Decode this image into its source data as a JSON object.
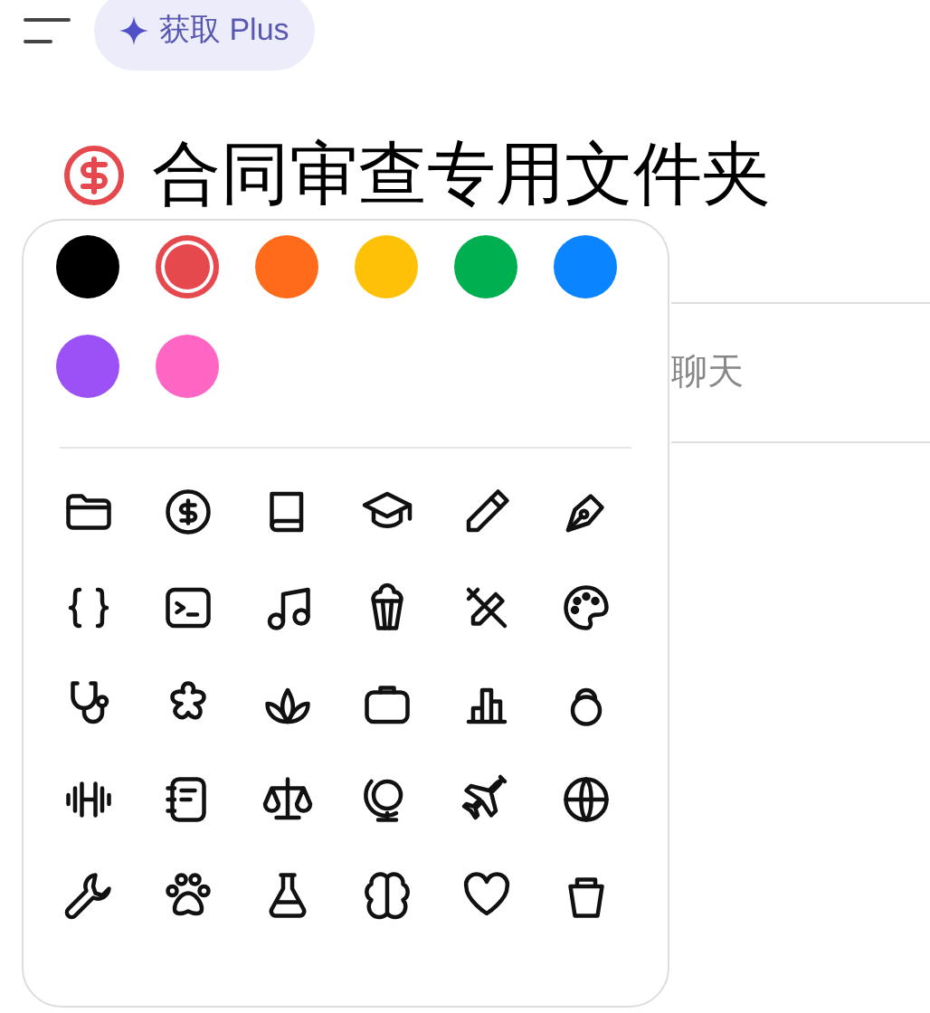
{
  "header": {
    "upgrade_button": {
      "label": "获取 Plus"
    }
  },
  "project": {
    "title": "合同审查专用文件夹"
  },
  "chat_field": {
    "placeholder": "聊天"
  },
  "color_picker": {
    "colors": [
      {
        "color": "#000000",
        "selected": false
      },
      {
        "color": "#e5484d",
        "selected": true
      },
      {
        "color": "#ff6b1a",
        "selected": false
      },
      {
        "color": "#ffc107",
        "selected": false
      },
      {
        "color": "#00b050",
        "selected": false
      },
      {
        "color": "#0a84ff",
        "selected": false
      },
      {
        "color": "#9b51f5",
        "selected": false
      },
      {
        "color": "#ff66c4",
        "selected": false
      }
    ]
  }
}
